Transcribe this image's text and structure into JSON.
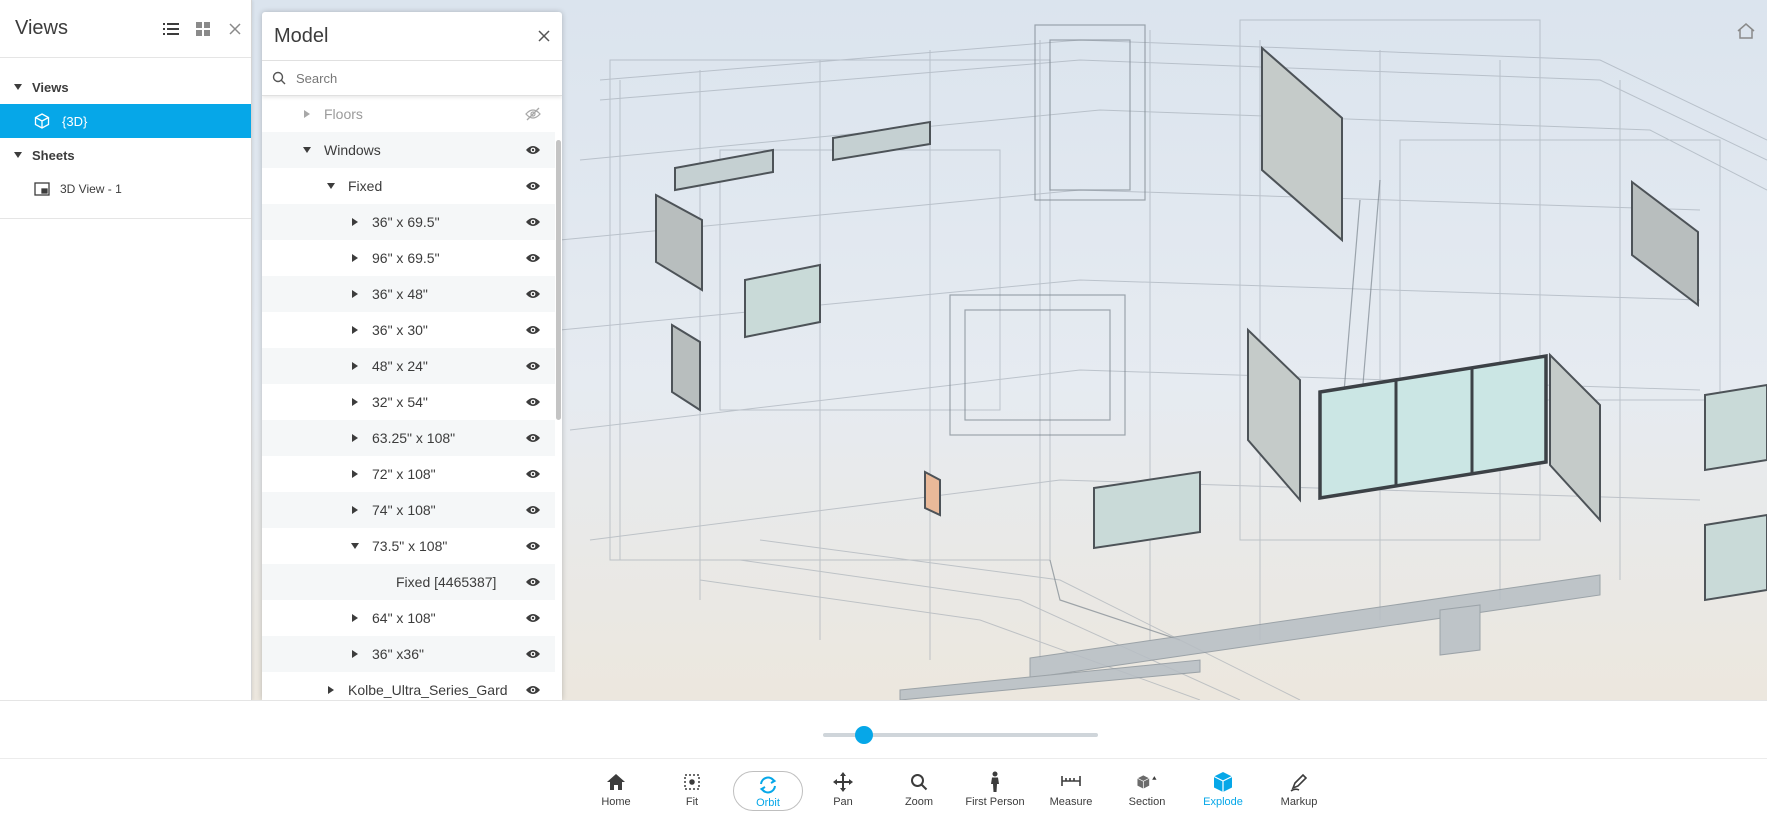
{
  "views_panel": {
    "title": "Views",
    "icons": [
      "list-icon",
      "grid-icon",
      "close-icon"
    ],
    "sections": {
      "views_label": "Views",
      "views_item": "{3D}",
      "sheets_label": "Sheets",
      "sheets_item": "3D View - 1"
    }
  },
  "model_panel": {
    "title": "Model",
    "search_placeholder": "Search",
    "rows": [
      {
        "label": "Floors",
        "level": 1,
        "expand": "collapsed",
        "visible": false
      },
      {
        "label": "Windows",
        "level": 1,
        "expand": "expanded",
        "visible": true
      },
      {
        "label": "Fixed",
        "level": 2,
        "expand": "expanded",
        "visible": true
      },
      {
        "label": "36\" x 69.5\"",
        "level": 3,
        "expand": "collapsed",
        "visible": true
      },
      {
        "label": "96\" x 69.5\"",
        "level": 3,
        "expand": "collapsed",
        "visible": true
      },
      {
        "label": "36\" x 48\"",
        "level": 3,
        "expand": "collapsed",
        "visible": true
      },
      {
        "label": "36\" x 30\"",
        "level": 3,
        "expand": "collapsed",
        "visible": true
      },
      {
        "label": "48\" x 24\"",
        "level": 3,
        "expand": "collapsed",
        "visible": true
      },
      {
        "label": "32\" x 54\"",
        "level": 3,
        "expand": "collapsed",
        "visible": true
      },
      {
        "label": "63.25\" x 108\"",
        "level": 3,
        "expand": "collapsed",
        "visible": true
      },
      {
        "label": "72\" x 108\"",
        "level": 3,
        "expand": "collapsed",
        "visible": true
      },
      {
        "label": "74\" x 108\"",
        "level": 3,
        "expand": "collapsed",
        "visible": true
      },
      {
        "label": "73.5\" x 108\"",
        "level": 3,
        "expand": "expanded",
        "visible": true
      },
      {
        "label": "Fixed [4465387]",
        "level": 4,
        "expand": "none",
        "visible": true
      },
      {
        "label": "64\" x 108\"",
        "level": 3,
        "expand": "collapsed",
        "visible": true
      },
      {
        "label": "36\" x36\"",
        "level": 3,
        "expand": "collapsed",
        "visible": true
      },
      {
        "label": "Kolbe_Ultra_Series_Gard",
        "level": 2,
        "expand": "collapsed",
        "visible": true
      }
    ]
  },
  "explode": {
    "value": 0.15
  },
  "toolbar": {
    "accent": "#06a7e8",
    "tools": [
      {
        "label": "Home",
        "icon": "home-icon",
        "active": false
      },
      {
        "label": "Fit",
        "icon": "fit-icon",
        "active": false
      },
      {
        "label": "Orbit",
        "icon": "orbit-icon",
        "active": true
      },
      {
        "label": "Pan",
        "icon": "pan-icon",
        "active": false
      },
      {
        "label": "Zoom",
        "icon": "zoom-icon",
        "active": false
      },
      {
        "label": "First Person",
        "icon": "first-person-icon",
        "active": false
      },
      {
        "label": "Measure",
        "icon": "measure-icon",
        "active": false
      },
      {
        "label": "Section",
        "icon": "section-icon",
        "active": false
      },
      {
        "label": "Explode",
        "icon": "explode-icon",
        "active": true
      },
      {
        "label": "Markup",
        "icon": "markup-icon",
        "active": false
      }
    ]
  }
}
